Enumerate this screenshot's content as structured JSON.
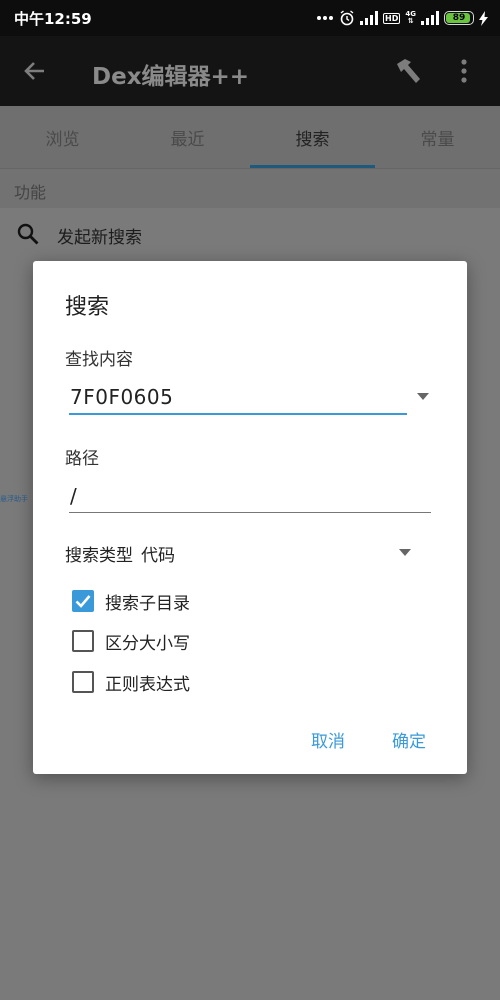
{
  "status_bar": {
    "time": "中午12:59",
    "network": "4G",
    "hd": "HD",
    "battery": "89"
  },
  "app_bar": {
    "title": "Dex编辑器++",
    "icons": [
      "back-arrow-icon",
      "hammer-icon",
      "more-vert-icon"
    ]
  },
  "tabs": [
    {
      "label": "浏览"
    },
    {
      "label": "最近"
    },
    {
      "label": "搜索",
      "active": true
    },
    {
      "label": "常量"
    }
  ],
  "section": {
    "header": "功能"
  },
  "new_search": {
    "label": "发起新搜索",
    "icon": "search-icon"
  },
  "side_tag": "悬浮助手",
  "dialog": {
    "title": "搜索",
    "find_label": "查找内容",
    "find_value": "7F0F0605",
    "path_label": "路径",
    "path_value": "/",
    "type_label": "搜索类型",
    "type_value": "代码",
    "checkboxes": [
      {
        "label": "搜索子目录",
        "checked": true
      },
      {
        "label": "区分大小写",
        "checked": false
      },
      {
        "label": "正则表达式",
        "checked": false
      }
    ],
    "cancel_label": "取消",
    "ok_label": "确定"
  },
  "colors": {
    "accent": "#3a9ad9",
    "status_bar": "#0d0d0d",
    "scrim_background": "#7a7a7a",
    "battery_fill": "#6bc43f"
  }
}
